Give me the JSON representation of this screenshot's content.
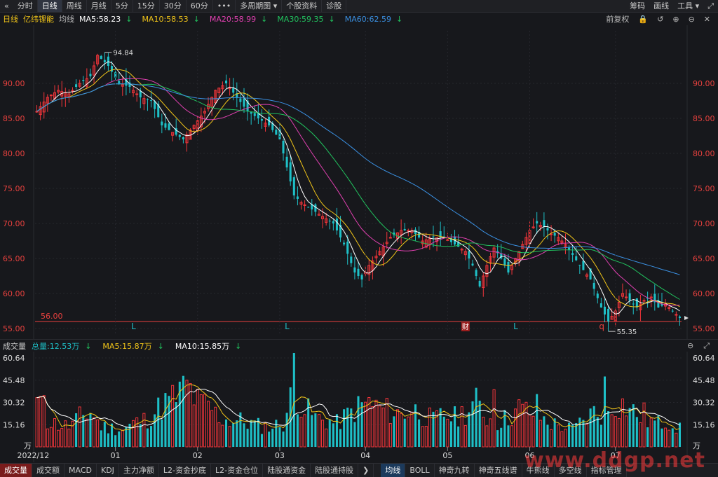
{
  "topbar": {
    "tabs": [
      "分时",
      "日线",
      "周线",
      "月线",
      "5分",
      "15分",
      "30分",
      "60分"
    ],
    "active_tab": 1,
    "more_label": "•••",
    "multi_period_label": "多周期图",
    "profile_label": "个股资料",
    "diagnose_label": "诊股",
    "right_items": [
      "筹码",
      "画线",
      "工具"
    ]
  },
  "header": {
    "period_label": "日线",
    "stock_name": "亿纬锂能",
    "ma_label": "均线",
    "ma_values": [
      {
        "text": "MA5:58.23",
        "color": "#ffffff"
      },
      {
        "text": "MA10:58.53",
        "color": "#f0c419"
      },
      {
        "text": "MA20:58.99",
        "color": "#e040b0"
      },
      {
        "text": "MA30:59.35",
        "color": "#21c25e"
      },
      {
        "text": "MA60:62.59",
        "color": "#3a8fe0"
      }
    ],
    "adjust_label": "前复权"
  },
  "volume_header": {
    "label": "成交量",
    "total": "总量:12.53万",
    "ma5": "MA5:15.87万",
    "ma10": "MA10:15.85万"
  },
  "bottombar": {
    "left_tabs": [
      "成交量",
      "成交额",
      "MACD",
      "KDJ",
      "主力净额",
      "L2-资金抄底",
      "L2-资金仓位",
      "陆股通资金",
      "陆股通持股"
    ],
    "right_tabs": [
      "均线",
      "BOLL",
      "神奇九转",
      "神奇五线谱",
      "牛熊线",
      "多空线",
      "指标管理"
    ],
    "active_left": 0,
    "active_right": 0
  },
  "colors": {
    "up": "#f2353a",
    "down": "#1ec0c7",
    "ma5": "#ffffff",
    "ma10": "#f0c419",
    "ma20": "#e040b0",
    "ma30": "#21c25e",
    "ma60": "#3a8fe0",
    "axis_text": "#e8413e"
  },
  "chart_data": [
    {
      "type": "candlestick",
      "price_axis_ticks": [
        "90.00",
        "85.00",
        "80.00",
        "75.00",
        "70.00",
        "65.00",
        "60.00",
        "55.00"
      ],
      "ylim": [
        54.3,
        97.5
      ],
      "x_month_labels": [
        "2022/12",
        "01",
        "02",
        "03",
        "04",
        "05",
        "06",
        "07"
      ],
      "high_label": "94.84",
      "low_label": "55.35",
      "support_line": {
        "value": 56.0,
        "label": "56.00"
      },
      "markers": [
        {
          "text": "L",
          "month_pos": "01"
        },
        {
          "text": "L",
          "month_pos": "03"
        },
        {
          "text": "财",
          "month_pos": "04"
        },
        {
          "text": "L",
          "month_pos": "05"
        },
        {
          "text": "q",
          "month_pos": "06"
        }
      ],
      "anchors": [
        [
          0,
          86
        ],
        [
          3,
          88
        ],
        [
          6,
          89
        ],
        [
          9,
          88.5
        ],
        [
          12,
          90
        ],
        [
          15,
          91
        ],
        [
          17,
          94
        ],
        [
          20,
          92.5
        ],
        [
          23,
          90
        ],
        [
          26,
          89.5
        ],
        [
          29,
          88
        ],
        [
          32,
          87.5
        ],
        [
          35,
          84
        ],
        [
          38,
          83
        ],
        [
          41,
          82
        ],
        [
          44,
          84
        ],
        [
          47,
          86
        ],
        [
          50,
          89
        ],
        [
          53,
          90
        ],
        [
          56,
          88
        ],
        [
          59,
          86
        ],
        [
          62,
          85
        ],
        [
          65,
          84
        ],
        [
          68,
          82
        ],
        [
          70,
          78
        ],
        [
          72,
          74
        ],
        [
          74,
          73
        ],
        [
          77,
          72
        ],
        [
          80,
          71
        ],
        [
          83,
          70
        ],
        [
          86,
          67
        ],
        [
          89,
          63
        ],
        [
          91,
          62
        ],
        [
          93,
          64
        ],
        [
          96,
          66
        ],
        [
          99,
          68
        ],
        [
          102,
          69
        ],
        [
          105,
          69
        ],
        [
          108,
          67.5
        ],
        [
          111,
          68
        ],
        [
          114,
          68
        ],
        [
          117,
          67
        ],
        [
          120,
          66
        ],
        [
          122,
          64
        ],
        [
          124,
          61
        ],
        [
          126,
          64
        ],
        [
          128,
          66.5
        ],
        [
          130,
          65
        ],
        [
          132,
          63
        ],
        [
          135,
          66
        ],
        [
          138,
          69
        ],
        [
          140,
          70
        ],
        [
          142,
          69.5
        ],
        [
          144,
          68.5
        ],
        [
          146,
          68
        ],
        [
          148,
          67
        ],
        [
          150,
          65.5
        ],
        [
          152,
          64
        ],
        [
          155,
          62
        ],
        [
          158,
          58
        ],
        [
          160,
          56
        ],
        [
          162,
          57.5
        ],
        [
          164,
          60
        ],
        [
          166,
          59
        ],
        [
          168,
          58
        ],
        [
          170,
          59
        ],
        [
          172,
          59.5
        ],
        [
          174,
          58
        ],
        [
          176,
          58.5
        ],
        [
          178,
          57.5
        ],
        [
          180,
          56.5
        ]
      ],
      "candle_count": 181
    },
    {
      "type": "bar",
      "series_name": "成交量",
      "units": "万",
      "y_ticks": [
        "60.64",
        "45.48",
        "30.32",
        "15.16"
      ],
      "ylim": [
        0,
        64
      ],
      "anchors": [
        [
          0,
          30
        ],
        [
          3,
          18
        ],
        [
          6,
          15
        ],
        [
          9,
          14
        ],
        [
          12,
          20
        ],
        [
          15,
          24
        ],
        [
          18,
          14
        ],
        [
          21,
          13
        ],
        [
          24,
          12
        ],
        [
          27,
          16
        ],
        [
          30,
          18
        ],
        [
          33,
          24
        ],
        [
          36,
          30
        ],
        [
          39,
          34
        ],
        [
          42,
          42
        ],
        [
          45,
          30
        ],
        [
          48,
          28
        ],
        [
          51,
          20
        ],
        [
          54,
          18
        ],
        [
          57,
          18
        ],
        [
          60,
          16
        ],
        [
          63,
          14
        ],
        [
          66,
          14
        ],
        [
          69,
          16
        ],
        [
          72,
          40
        ],
        [
          75,
          26
        ],
        [
          78,
          20
        ],
        [
          81,
          18
        ],
        [
          84,
          16
        ],
        [
          87,
          22
        ],
        [
          90,
          27
        ],
        [
          93,
          30
        ],
        [
          96,
          26
        ],
        [
          99,
          24
        ],
        [
          102,
          22
        ],
        [
          105,
          26
        ],
        [
          108,
          22
        ],
        [
          111,
          18
        ],
        [
          114,
          22
        ],
        [
          117,
          20
        ],
        [
          120,
          24
        ],
        [
          123,
          30
        ],
        [
          126,
          20
        ],
        [
          129,
          17
        ],
        [
          132,
          20
        ],
        [
          135,
          26
        ],
        [
          138,
          24
        ],
        [
          141,
          20
        ],
        [
          144,
          16
        ],
        [
          147,
          14
        ],
        [
          150,
          12
        ],
        [
          153,
          18
        ],
        [
          156,
          24
        ],
        [
          159,
          22
        ],
        [
          162,
          30
        ],
        [
          165,
          28
        ],
        [
          168,
          22
        ],
        [
          171,
          18
        ],
        [
          174,
          16
        ],
        [
          177,
          18
        ],
        [
          180,
          12
        ]
      ],
      "spikes": [
        [
          2,
          35
        ],
        [
          72,
          64
        ],
        [
          128,
          39
        ],
        [
          140,
          36
        ],
        [
          159,
          48
        ],
        [
          170,
          30
        ]
      ]
    }
  ]
}
